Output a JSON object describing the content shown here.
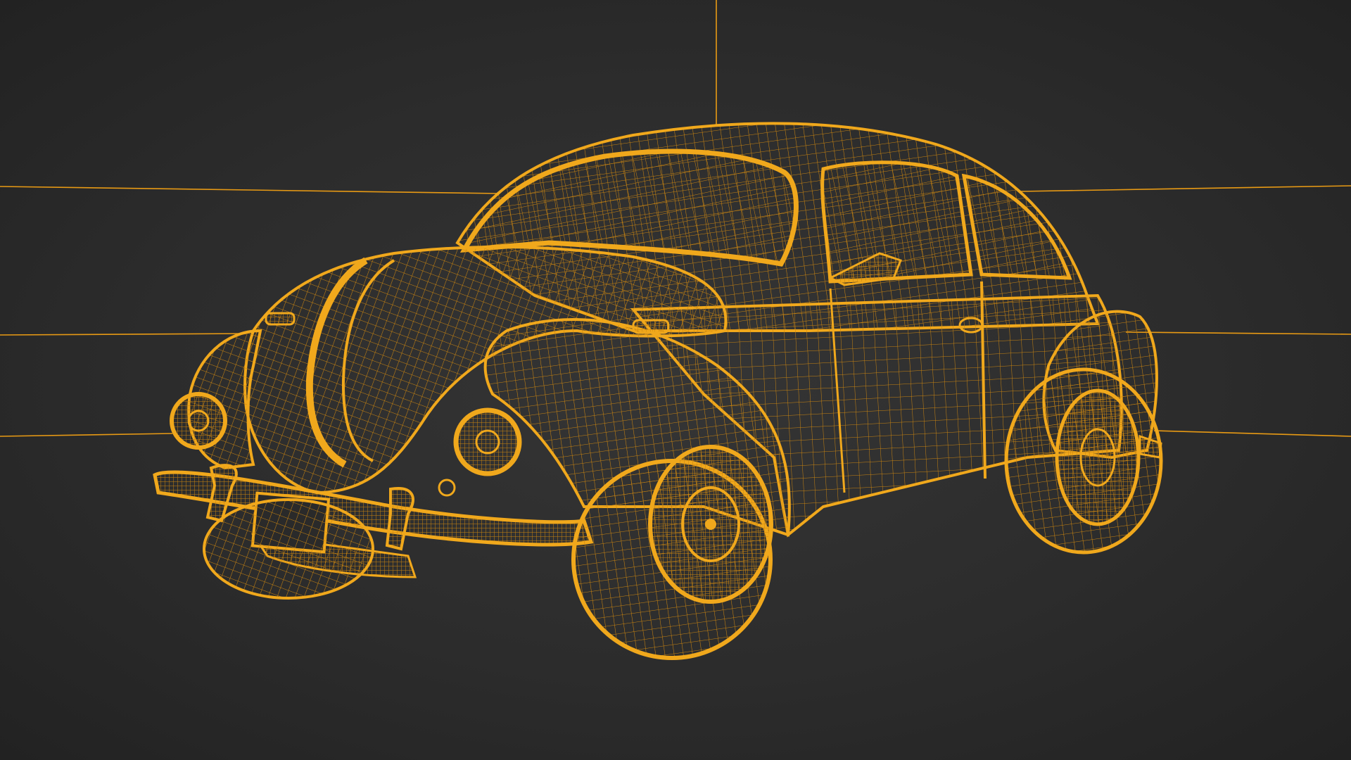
{
  "scene": {
    "subject": "car-wireframe",
    "background_color": "#2b2b2b",
    "wire_color": "#f0a81c",
    "wire_dark_color": "#c98410",
    "plate_color": "#2a2a2a"
  }
}
